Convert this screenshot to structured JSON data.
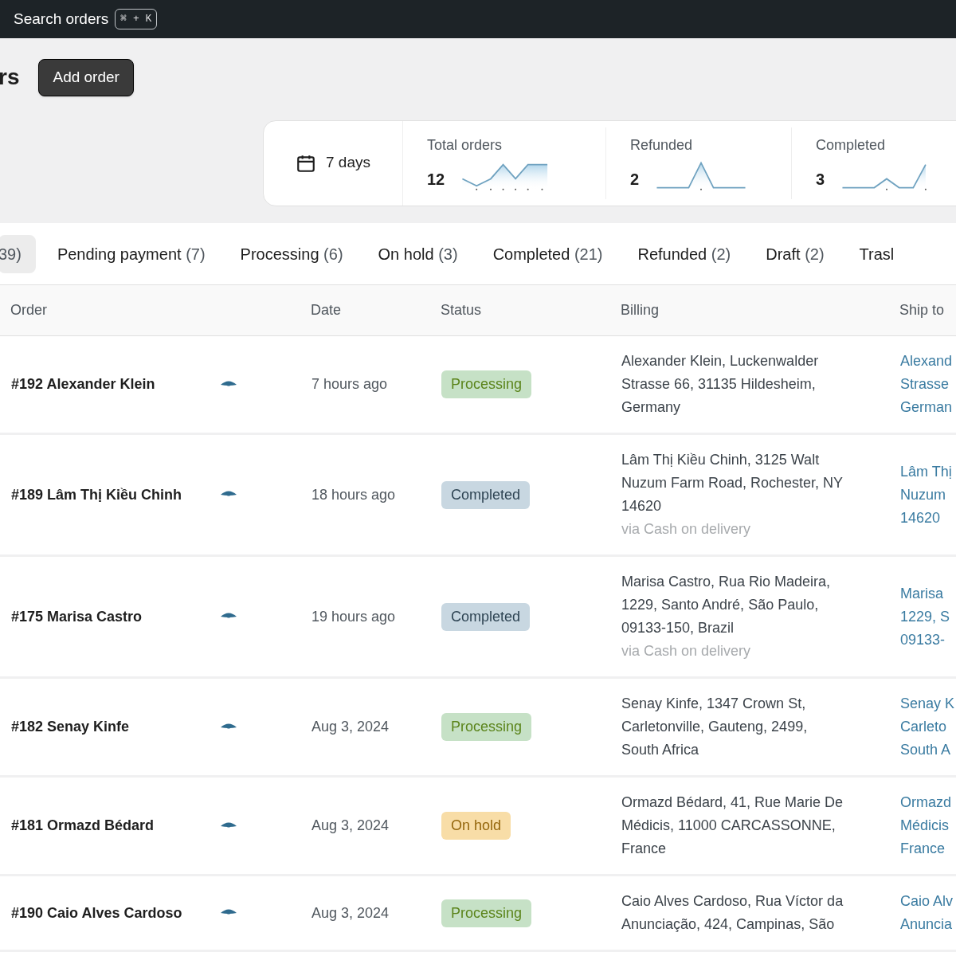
{
  "topbar": {
    "search_button": {
      "label": "Search orders",
      "shortcut": "⌘ + K"
    }
  },
  "header": {
    "title": "rs",
    "add_button": "Add order"
  },
  "stats": {
    "period": "7 days",
    "cards": [
      {
        "label": "Total orders",
        "value": "12"
      },
      {
        "label": "Refunded",
        "value": "2"
      },
      {
        "label": "Completed",
        "value": "3"
      }
    ]
  },
  "tabs": [
    {
      "count": "39)",
      "selected": true
    },
    {
      "label": "Pending payment",
      "count": "(7)",
      "selected": false
    },
    {
      "label": "Processing",
      "count": "(6)",
      "selected": false
    },
    {
      "label": "On hold",
      "count": "(3)",
      "selected": false
    },
    {
      "label": "Completed",
      "count": "(21)",
      "selected": false
    },
    {
      "label": "Refunded",
      "count": "(2)",
      "selected": false
    },
    {
      "label": "Draft",
      "count": "(2)",
      "selected": false
    },
    {
      "label": "Trasl",
      "selected": false
    }
  ],
  "table": {
    "columns": [
      "Order",
      "Date",
      "Status",
      "Billing",
      "Ship to"
    ],
    "rows": [
      {
        "order": "#192 Alexander Klein",
        "date": "7 hours ago",
        "status": {
          "label": "Processing",
          "kind": "processing"
        },
        "billing": [
          "Alexander Klein, Luckenwalder",
          "Strasse 66, 31135 Hildesheim,",
          "Germany"
        ],
        "ship_to": [
          "Alexand",
          "Strasse",
          "German"
        ]
      },
      {
        "order": "#189 Lâm Thị Kiều Chinh",
        "date": "18 hours ago",
        "status": {
          "label": "Completed",
          "kind": "completed"
        },
        "billing": [
          "Lâm Thị Kiều Chinh, 3125 Walt",
          "Nuzum Farm Road, Rochester, NY",
          "14620"
        ],
        "payment": "via Cash on delivery",
        "ship_to": [
          "Lâm Thị",
          "Nuzum",
          "14620"
        ]
      },
      {
        "order": "#175 Marisa Castro",
        "date": "19 hours ago",
        "status": {
          "label": "Completed",
          "kind": "completed"
        },
        "billing": [
          "Marisa Castro, Rua Rio Madeira,",
          "1229, Santo André, São Paulo,",
          "09133-150, Brazil"
        ],
        "payment": "via Cash on delivery",
        "ship_to": [
          "Marisa",
          "1229, S",
          "09133-"
        ]
      },
      {
        "order": "#182 Senay Kinfe",
        "date": "Aug 3, 2024",
        "status": {
          "label": "Processing",
          "kind": "processing"
        },
        "billing": [
          "Senay Kinfe, 1347 Crown St,",
          "Carletonville, Gauteng, 2499,",
          "South Africa"
        ],
        "ship_to": [
          "Senay K",
          "Carleto",
          "South A"
        ]
      },
      {
        "order": "#181 Ormazd Bédard",
        "date": "Aug 3, 2024",
        "status": {
          "label": "On hold",
          "kind": "on_hold"
        },
        "billing": [
          "Ormazd Bédard, 41, Rue Marie De",
          "Médicis, 11000 CARCASSONNE,",
          "France"
        ],
        "ship_to": [
          "Ormazd",
          "Médicis",
          "France"
        ]
      },
      {
        "order": "#190 Caio Alves Cardoso",
        "date": "Aug 3, 2024",
        "status": {
          "label": "Processing",
          "kind": "processing"
        },
        "billing": [
          "Caio Alves Cardoso, Rua Víctor da",
          "Anunciação, 424, Campinas, São"
        ],
        "ship_to": [
          "Caio Alv",
          "Anuncia"
        ]
      }
    ]
  }
}
